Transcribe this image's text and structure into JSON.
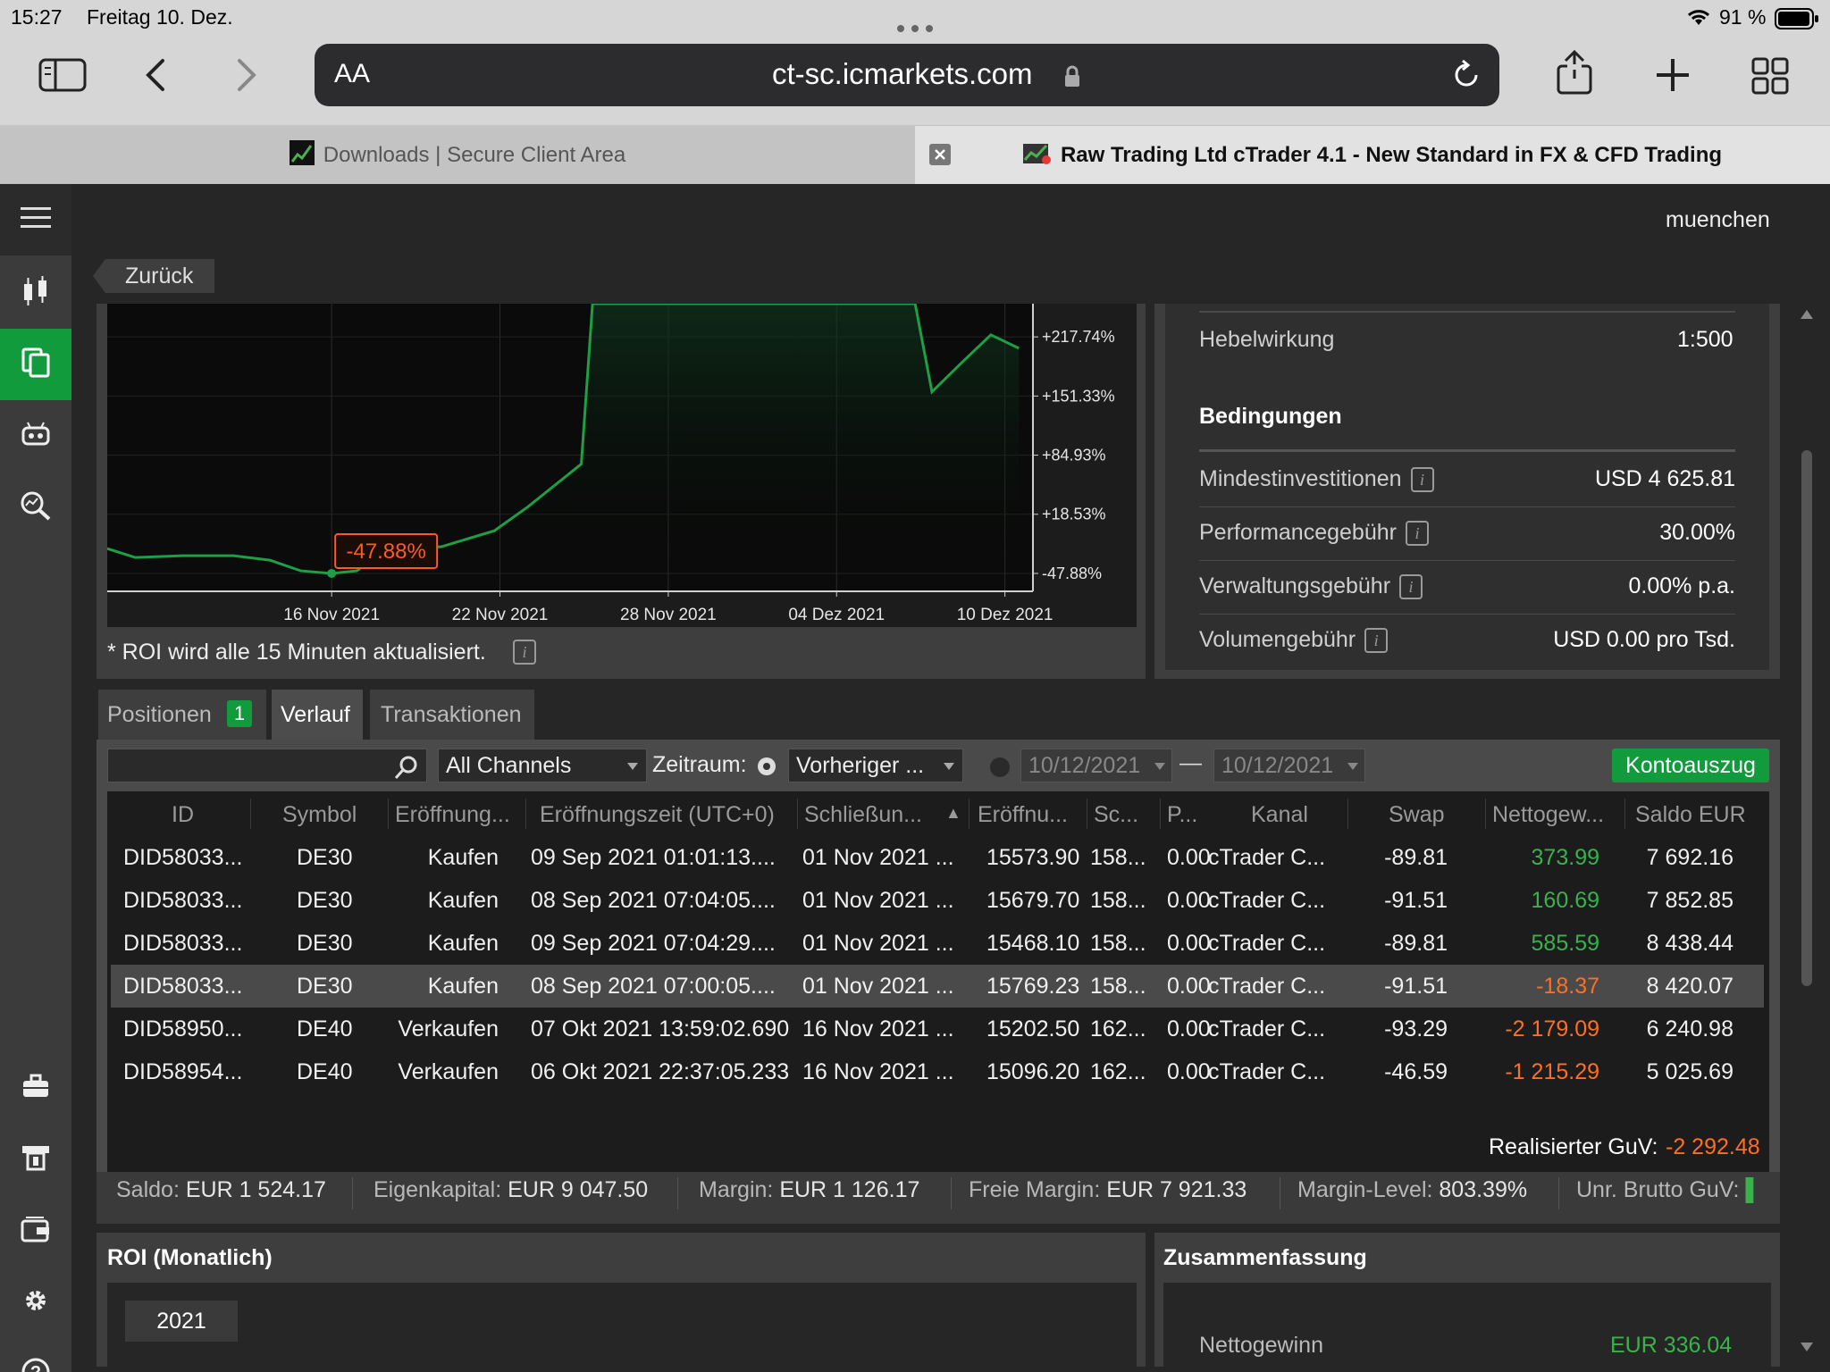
{
  "status": {
    "time": "15:27",
    "date": "Freitag 10. Dez.",
    "battery": "91 %"
  },
  "browser": {
    "address_size_label": "AA",
    "url": "ct-sc.icmarkets.com",
    "tabs": [
      {
        "title": "Downloads | Secure Client Area",
        "active": false
      },
      {
        "title": "Raw Trading Ltd cTrader 4.1 - New Standard in FX & CFD Trading",
        "active": true
      }
    ]
  },
  "app": {
    "user": "muenchen",
    "back_label": "Zurück",
    "sidebar_icons": [
      "menu-icon",
      "candlestick-icon",
      "copy-icon",
      "robot-icon",
      "analyze-icon",
      "briefcase-icon",
      "atm-icon",
      "wallet-icon",
      "gear-icon",
      "help-icon"
    ]
  },
  "chart_data": {
    "type": "line",
    "x_ticks": [
      "16 Nov 2021",
      "22 Nov 2021",
      "28 Nov 2021",
      "04 Dez 2021",
      "10 Dez 2021"
    ],
    "y_ticks": [
      "+217.74%",
      "+151.33%",
      "+84.93%",
      "+18.53%",
      "-47.88%"
    ],
    "y_tick_values": [
      217.74,
      151.33,
      84.93,
      18.53,
      -47.88
    ],
    "ylim": [
      -68,
      255
    ],
    "x_range_days": [
      8,
      41
    ],
    "series": [
      {
        "points": [
          [
            8.0,
            -20
          ],
          [
            9.0,
            -30
          ],
          [
            10.7,
            -28
          ],
          [
            12.5,
            -28
          ],
          [
            13.8,
            -33
          ],
          [
            14.9,
            -45
          ],
          [
            16.0,
            -47.88
          ],
          [
            16.9,
            -45
          ],
          [
            17.9,
            -20
          ],
          [
            19.9,
            -18
          ],
          [
            21.8,
            0
          ],
          [
            23.0,
            27
          ],
          [
            24.9,
            75
          ],
          [
            25.3,
            340
          ],
          [
            36.8,
            340
          ],
          [
            37.4,
            156
          ],
          [
            38.5,
            190
          ],
          [
            39.5,
            220
          ],
          [
            40.5,
            205
          ]
        ]
      }
    ],
    "marker_label": "-47.88%",
    "note": "* ROI wird alle 15 Minuten aktualisiert."
  },
  "conditions": {
    "leverage_label": "Hebelwirkung",
    "leverage_value": "1:500",
    "heading": "Bedingungen",
    "rows": [
      {
        "label": "Mindestinvestitionen",
        "value": "USD 4 625.81"
      },
      {
        "label": "Performancegebühr",
        "value": "30.00%"
      },
      {
        "label": "Verwaltungsgebühr",
        "value": "0.00% p.a."
      },
      {
        "label": "Volumengebühr",
        "value": "USD 0.00 pro Tsd."
      }
    ]
  },
  "tabs": {
    "positions": "Positionen",
    "positions_count": "1",
    "history": "Verlauf",
    "transactions": "Transaktionen"
  },
  "filters": {
    "channel": "All Channels",
    "period_label": "Zeitraum:",
    "period": "Vorheriger ...",
    "date_from": "10/12/2021",
    "date_to": "10/12/2021",
    "dash": "—",
    "statement": "Kontoauszug"
  },
  "table": {
    "columns": [
      "ID",
      "Symbol",
      "Eröffnung...",
      "Eröffnungszeit (UTC+0)",
      "Schließun...",
      "Eröffnu...",
      "Sc...",
      "P...",
      "Kanal",
      "Swap",
      "Nettogew...",
      "Saldo EUR"
    ],
    "rows": [
      {
        "id": "DID58033...",
        "symbol": "DE30",
        "dir": "Kaufen",
        "open_time": "09 Sep 2021 01:01:13....",
        "close_time": "01 Nov 2021 ...",
        "open_price": "15573.90",
        "close_price": "158...",
        "p": "0.00",
        "channel": "cTrader C...",
        "swap": "-89.81",
        "net": "373.99",
        "net_color": "green",
        "balance": "7 692.16",
        "selected": false
      },
      {
        "id": "DID58033...",
        "symbol": "DE30",
        "dir": "Kaufen",
        "open_time": "08 Sep 2021 07:04:05....",
        "close_time": "01 Nov 2021 ...",
        "open_price": "15679.70",
        "close_price": "158...",
        "p": "0.00",
        "channel": "cTrader C...",
        "swap": "-91.51",
        "net": "160.69",
        "net_color": "green",
        "balance": "7 852.85",
        "selected": false
      },
      {
        "id": "DID58033...",
        "symbol": "DE30",
        "dir": "Kaufen",
        "open_time": "09 Sep 2021 07:04:29....",
        "close_time": "01 Nov 2021 ...",
        "open_price": "15468.10",
        "close_price": "158...",
        "p": "0.00",
        "channel": "cTrader C...",
        "swap": "-89.81",
        "net": "585.59",
        "net_color": "green",
        "balance": "8 438.44",
        "selected": false
      },
      {
        "id": "DID58033...",
        "symbol": "DE30",
        "dir": "Kaufen",
        "open_time": "08 Sep 2021 07:00:05....",
        "close_time": "01 Nov 2021 ...",
        "open_price": "15769.23",
        "close_price": "158...",
        "p": "0.00",
        "channel": "cTrader C...",
        "swap": "-91.51",
        "net": "-18.37",
        "net_color": "orange",
        "balance": "8 420.07",
        "selected": true
      },
      {
        "id": "DID58950...",
        "symbol": "DE40",
        "dir": "Verkaufen",
        "open_time": "07 Okt 2021 13:59:02.690",
        "close_time": "16 Nov 2021 ...",
        "open_price": "15202.50",
        "close_price": "162...",
        "p": "0.00",
        "channel": "cTrader C...",
        "swap": "-93.29",
        "net": "-2 179.09",
        "net_color": "orange",
        "balance": "6 240.98",
        "selected": false
      },
      {
        "id": "DID58954...",
        "symbol": "DE40",
        "dir": "Verkaufen",
        "open_time": "06 Okt 2021 22:37:05.233",
        "close_time": "16 Nov 2021 ...",
        "open_price": "15096.20",
        "close_price": "162...",
        "p": "0.00",
        "channel": "cTrader C...",
        "swap": "-46.59",
        "net": "-1 215.29",
        "net_color": "orange",
        "balance": "5 025.69",
        "selected": false
      }
    ],
    "realized_label": "Realisierter GuV:",
    "realized_value": "-2 292.48"
  },
  "account": {
    "saldo_label": "Saldo:",
    "saldo": "EUR 1 524.17",
    "equity_label": "Eigenkapital:",
    "equity": "EUR 9 047.50",
    "margin_label": "Margin:",
    "margin": "EUR 1 126.17",
    "free_label": "Freie Margin:",
    "free": "EUR 7 921.33",
    "level_label": "Margin-Level:",
    "level": "803.39%",
    "unr_label": "Unr. Brutto GuV:"
  },
  "roi": {
    "title": "ROI (Monatlich)",
    "year": "2021"
  },
  "summary": {
    "title": "Zusammenfassung",
    "net_label": "Nettogewinn",
    "net_value": "EUR 336.04"
  }
}
